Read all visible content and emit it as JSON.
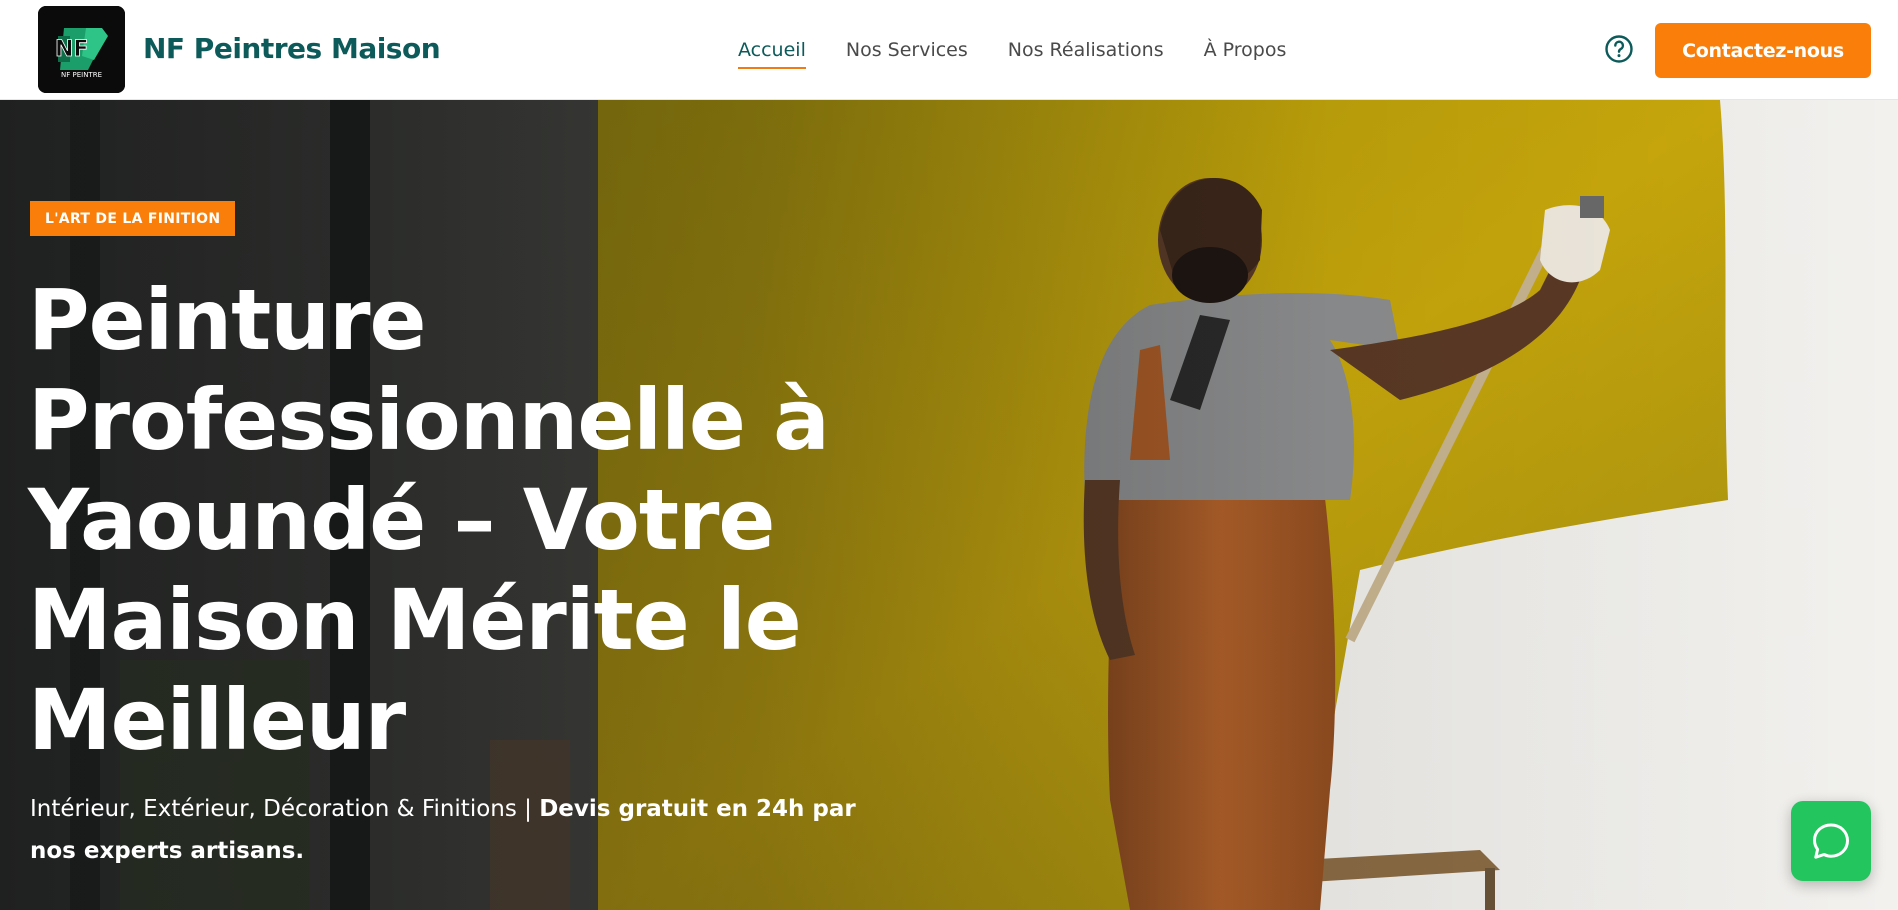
{
  "header": {
    "logo_text": "NF PEINTRE",
    "brand_name": "NF Peintres Maison",
    "nav": [
      {
        "label": "Accueil",
        "active": true
      },
      {
        "label": "Nos Services",
        "active": false
      },
      {
        "label": "Nos Réalisations",
        "active": false
      },
      {
        "label": "À Propos",
        "active": false
      }
    ],
    "help_icon": "help-circle-icon",
    "cta_label": "Contactez-nous"
  },
  "hero": {
    "badge": "L'ART DE LA FINITION",
    "headline": "Peinture Professionnelle à Yaoundé – Votre Maison Mérite le Meilleur",
    "subline_regular": "Intérieur, Extérieur, Décoration & Finitions | ",
    "subline_bold": "Devis gratuit en 24h par nos experts artisans.",
    "chat_icon": "chat-bubble-icon"
  },
  "colors": {
    "accent": "#f97f0a",
    "brand": "#0d5a5a",
    "chat": "#22c55e"
  }
}
